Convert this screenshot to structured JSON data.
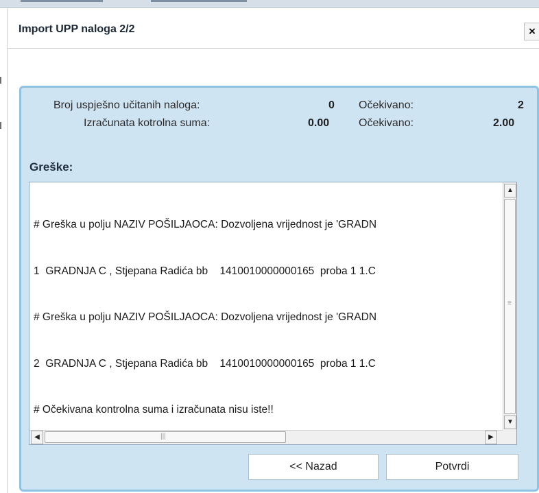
{
  "dialog": {
    "title": "Import UPP naloga 2/2",
    "close_glyph": "×"
  },
  "summary": {
    "loaded_label": "Broj uspješno učitanih naloga:",
    "loaded_value": "0",
    "expected_label_1": "Očekivano:",
    "expected_value_1": "2",
    "checksum_label": "Izračunata kotrolna suma:",
    "checksum_value": "0.00",
    "expected_label_2": "Očekivano:",
    "expected_value_2": "2.00"
  },
  "errors": {
    "heading": "Greške:",
    "lines": [
      "# Greška u polju NAZIV POŠILJAOCA: Dozvoljena vrijednost je 'GRADN",
      "1  GRADNJA C , Stjepana Radića bb    1410010000000165  proba 1 1.C",
      "# Greška u polju NAZIV POŠILJAOCA: Dozvoljena vrijednost je 'GRADN",
      "2  GRADNJA C , Stjepana Radića bb    1410010000000165  proba 1 1.C",
      "# Očekivana kontrolna suma i izračunata nisu iste!!"
    ]
  },
  "buttons": {
    "back_label": "<< Nazad",
    "confirm_label": "Potvrdi"
  },
  "icons": {
    "close": "close-icon",
    "scroll_up": "arrow-up-icon",
    "scroll_down": "arrow-down-icon",
    "scroll_left": "arrow-left-icon",
    "scroll_right": "arrow-right-icon"
  },
  "colors": {
    "panel_bg": "#cfe4f3",
    "panel_border": "#8ec3e4"
  }
}
